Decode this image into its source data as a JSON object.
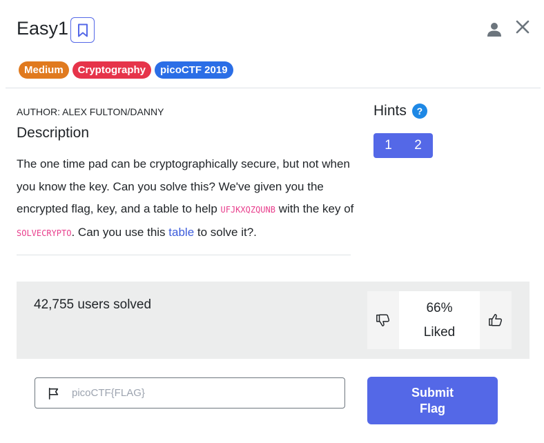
{
  "challenge": {
    "title": "Easy1",
    "tags": [
      "Medium",
      "Cryptography",
      "picoCTF 2019"
    ],
    "author": "AUTHOR: ALEX FULTON/DANNY",
    "description_heading": "Description",
    "description": {
      "part1": "The one time pad can be cryptographically secure, but not when you know the key. Can you solve this? We've given you the encrypted flag, key, and a table to help ",
      "cipher": "UFJKXQZQUNB",
      "part2": " with the key of ",
      "key": "SOLVECRYPTO",
      "part3": ". Can you use this ",
      "link": "table",
      "part4": " to solve it?."
    }
  },
  "hints": {
    "heading": "Hints",
    "help_symbol": "?",
    "buttons": [
      "1",
      "2"
    ]
  },
  "stats": {
    "solved": "42,755 users solved",
    "liked_percent": "66%",
    "liked_label": "Liked"
  },
  "flag_form": {
    "placeholder": "picoCTF{FLAG}",
    "submit_label": "Submit Flag"
  },
  "colors": {
    "accent": "#5468e7",
    "medium": "#e07a1f",
    "cryptography": "#e6344a",
    "event": "#2b6ee6",
    "code": "#e83e8c"
  },
  "icons": [
    "bookmark-icon",
    "user-icon",
    "close-icon",
    "help-icon",
    "thumbs-down-icon",
    "thumbs-up-icon",
    "flag-icon"
  ]
}
